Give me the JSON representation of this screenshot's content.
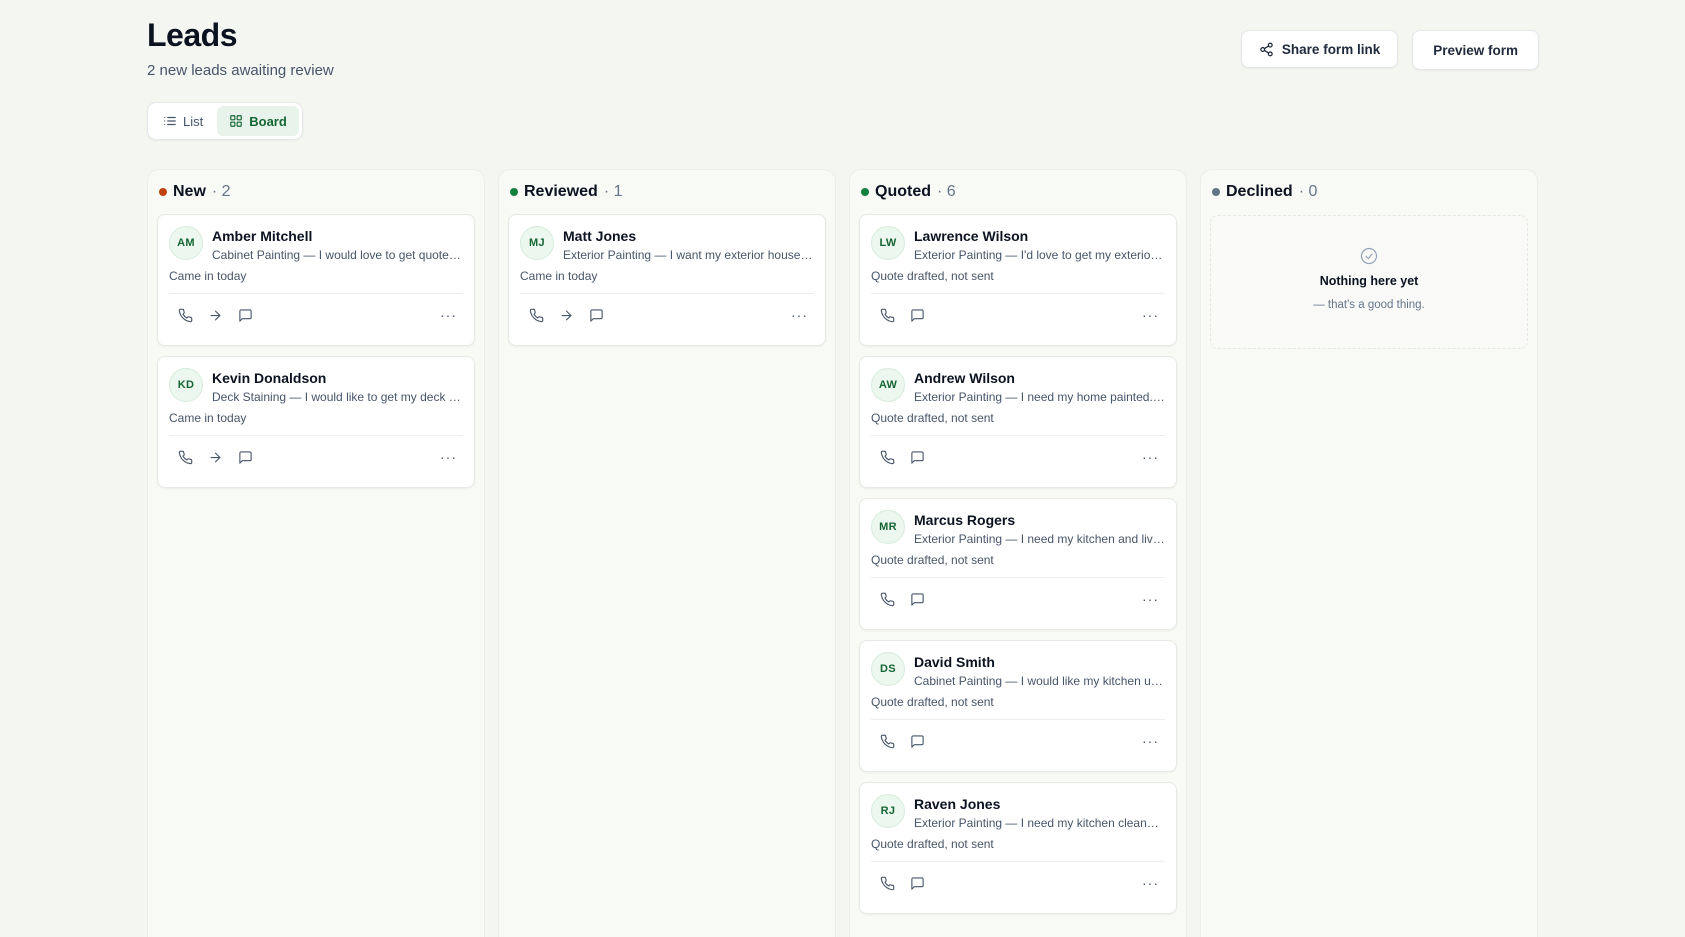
{
  "header": {
    "title": "Leads",
    "subtitle": "2 new leads awaiting review",
    "share_label": "Share form link",
    "preview_label": "Preview form"
  },
  "view_toggle": {
    "list_label": "List",
    "board_label": "Board",
    "active": "Board"
  },
  "colors": {
    "new": "#c2410c",
    "reviewed": "#15803d",
    "quoted": "#15803d",
    "declined": "#64748b"
  },
  "columns": [
    {
      "name": "New",
      "count": "· 2",
      "cards": [
        {
          "initials": "AM",
          "name": "Amber Mitchell",
          "desc": "Cabinet Painting — I would love to get quote on painting my cabinets",
          "status": "Came in today"
        },
        {
          "initials": "KD",
          "name": "Kevin Donaldson",
          "desc": "Deck Staining — I would like to get my deck stained this spring",
          "status": "Came in today"
        }
      ]
    },
    {
      "name": "Reviewed",
      "count": "· 1",
      "cards": [
        {
          "initials": "MJ",
          "name": "Matt Jones",
          "desc": "Exterior Painting — I want my exterior house painted before summer",
          "status": "Came in today"
        }
      ]
    },
    {
      "name": "Quoted",
      "count": "· 6",
      "cards": [
        {
          "initials": "LW",
          "name": "Lawrence Wilson",
          "desc": "Exterior Painting — I'd love to get my exterior repainted",
          "status": "Quote drafted, not sent"
        },
        {
          "initials": "AW",
          "name": "Andrew Wilson",
          "desc": "Exterior Painting — I need my home painted. It is two stories",
          "status": "Quote drafted, not sent"
        },
        {
          "initials": "MR",
          "name": "Marcus Rogers",
          "desc": "Exterior Painting — I need my kitchen and living room painted",
          "status": "Quote drafted, not sent"
        },
        {
          "initials": "DS",
          "name": "David Smith",
          "desc": "Cabinet Painting — I would like my kitchen updated with new color",
          "status": "Quote drafted, not sent"
        },
        {
          "initials": "RJ",
          "name": "Raven Jones",
          "desc": "Exterior Painting — I need my kitchen cleaned up and repainted",
          "status": "Quote drafted, not sent"
        }
      ]
    },
    {
      "name": "Declined",
      "count": "· 0",
      "empty_title": "Nothing here yet",
      "empty_sub": "— that's a good thing."
    }
  ],
  "card_actions": {
    "more_glyph": "···"
  }
}
